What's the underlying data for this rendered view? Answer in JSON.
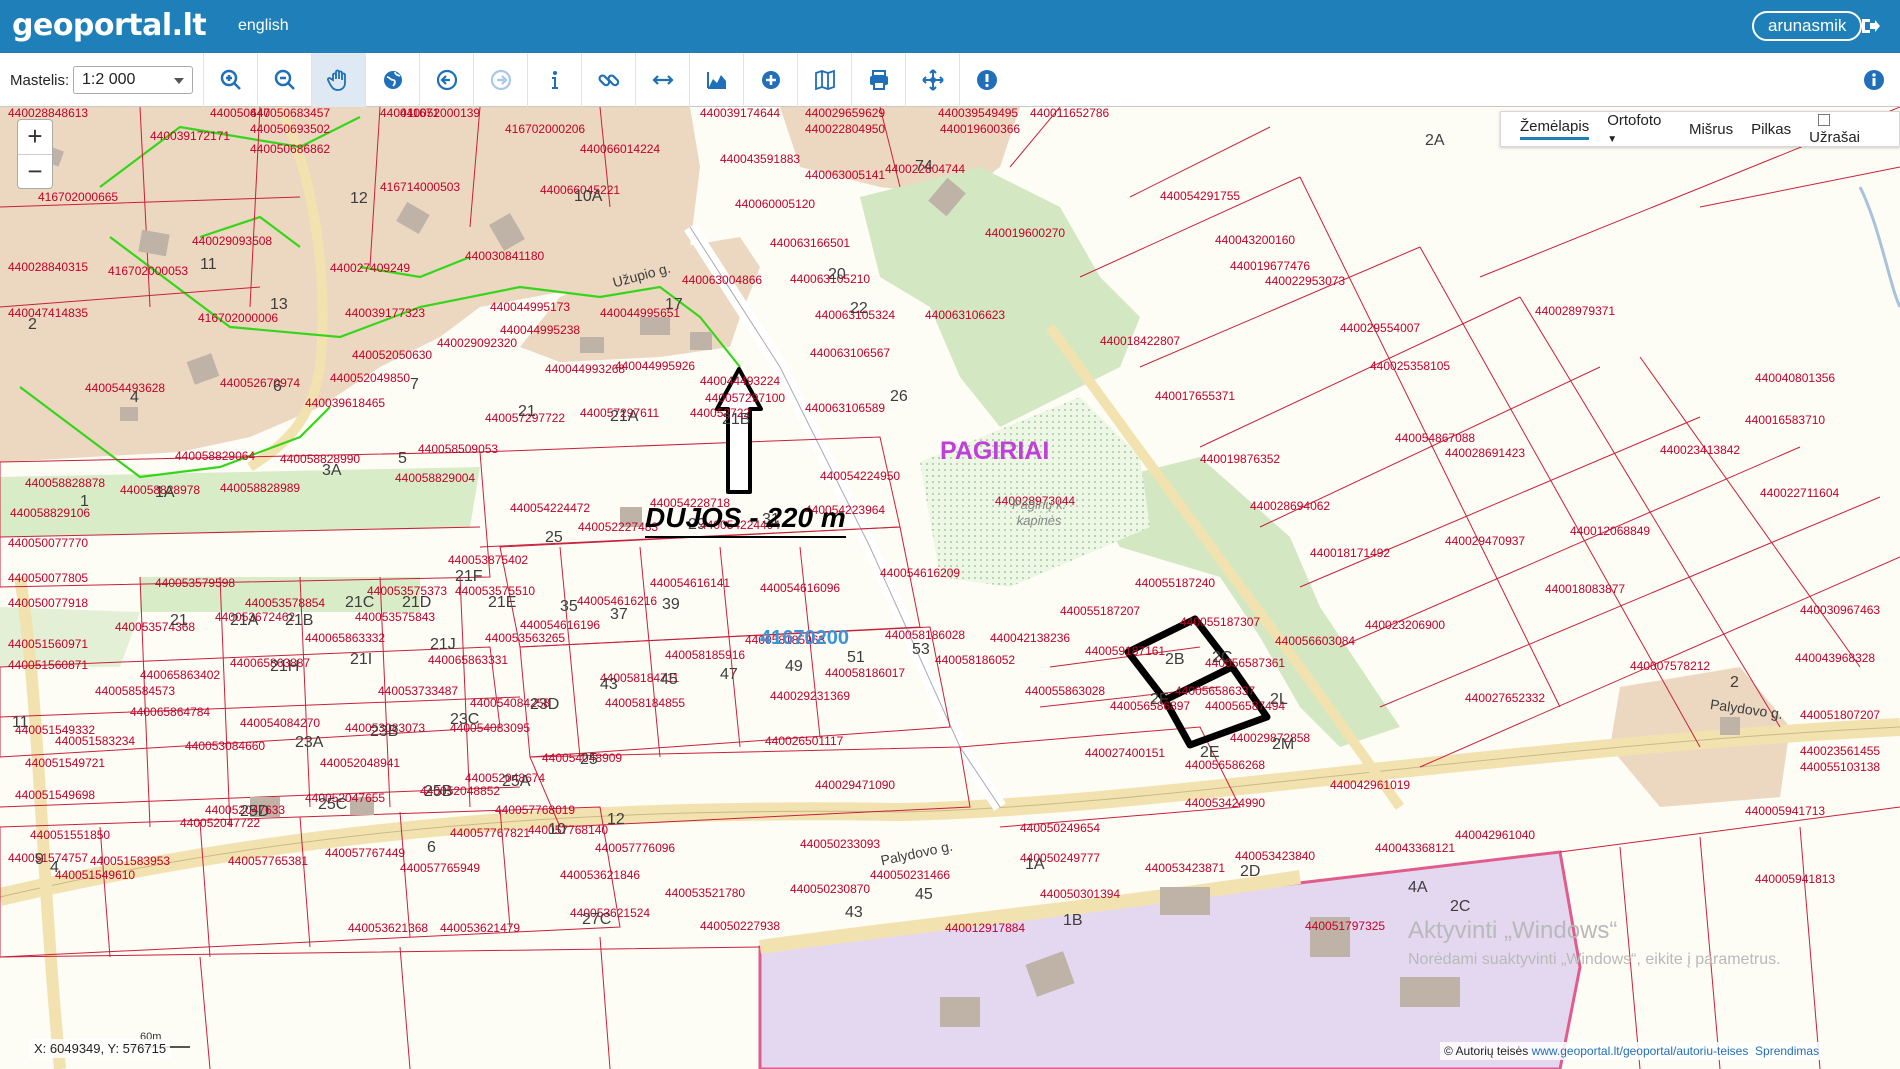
{
  "header": {
    "logo_text": "geoportal.lt",
    "language_link": "english",
    "user_button": "arunasmik"
  },
  "toolbar": {
    "scale_label": "Mastelis:",
    "scale_value": "1:2 000",
    "tools": [
      "zoom-in-tool",
      "zoom-out-tool",
      "pan-hand-tool",
      "globe-tool",
      "back-tool",
      "forward-tool",
      "identify-info-tool",
      "link-tool",
      "measure-distance-tool",
      "profile-tool",
      "add-point-tool",
      "map-tool",
      "print-tool",
      "center-tool",
      "alert-tool"
    ]
  },
  "map": {
    "zoom_in": "+",
    "zoom_out": "−",
    "layers": {
      "zemelapis": "Žemėlapis",
      "ortofoto": "Ortofoto",
      "misrus": "Mišrus",
      "pilkas": "Pilkas",
      "uzrasai": "Užrašai"
    },
    "place_name": "PAGIRIAI",
    "cemetery_line1": "Pagirių k.",
    "cemetery_line2": "kapinės",
    "parcel_block": "41670200",
    "annotation": "DUJOS - 220 m",
    "street_uzupio": "Užupio g.",
    "street_palydovo_1": "Palydovo g.",
    "street_palydovo_2": "Palydovo g.",
    "watermark_line1": "Aktyvinti „Windows“",
    "watermark_line2": "Norėdami suaktyvinti „Windows“, eikite į parametrus.",
    "coordinates": "X: 6049349, Y: 576715",
    "copyright_text": "© Autorių teisės",
    "copyright_link": "www.geoportal.lt/geoportal/autoriu-teises",
    "solutions_link": "Sprendimas",
    "scalebar": "60m"
  },
  "parcel_labels": [
    [
      "440028848613",
      8,
      0
    ],
    [
      "440050647",
      210,
      0
    ],
    [
      "440050683457",
      250,
      0
    ],
    [
      "440011671",
      380,
      0
    ],
    [
      "440052000139",
      400,
      0
    ],
    [
      "440039174644",
      700,
      0
    ],
    [
      "440029659629",
      805,
      0
    ],
    [
      "440039549495",
      938,
      0
    ],
    [
      "440011652786",
      1030,
      0
    ],
    [
      "440039172171",
      150,
      23
    ],
    [
      "440050693502",
      250,
      16
    ],
    [
      "416702000206",
      505,
      16
    ],
    [
      "440019600366",
      940,
      16
    ],
    [
      "440050686862",
      250,
      36
    ],
    [
      "440066014224",
      580,
      36
    ],
    [
      "440043591883",
      720,
      46
    ],
    [
      "440022804950",
      805,
      16
    ],
    [
      "440063005141",
      805,
      62
    ],
    [
      "440022804744",
      885,
      56
    ],
    [
      "416702000665",
      38,
      84
    ],
    [
      "416714000503",
      380,
      74
    ],
    [
      "440066045221",
      540,
      77
    ],
    [
      "440060005120",
      735,
      91
    ],
    [
      "440029093508",
      192,
      128
    ],
    [
      "440030841180",
      465,
      143
    ],
    [
      "440063166501",
      770,
      130
    ],
    [
      "440019600270",
      985,
      120
    ],
    [
      "440054291755",
      1160,
      83
    ],
    [
      "440043200160",
      1215,
      127
    ],
    [
      "440028840315",
      8,
      154
    ],
    [
      "416702000053",
      108,
      158
    ],
    [
      "440027409249",
      330,
      155
    ],
    [
      "440063004866",
      682,
      167
    ],
    [
      "440063105210",
      790,
      166
    ],
    [
      "440019677476",
      1230,
      153
    ],
    [
      "440022953073",
      1265,
      168
    ],
    [
      "440044995651",
      600,
      200
    ],
    [
      "440044995173",
      490,
      194
    ],
    [
      "440039177323",
      345,
      200
    ],
    [
      "440063105324",
      815,
      202
    ],
    [
      "440063106623",
      925,
      202
    ],
    [
      "440047414835",
      8,
      200
    ],
    [
      "416702000006",
      198,
      205
    ],
    [
      "440044995238",
      500,
      217
    ],
    [
      "440052050630",
      352,
      242
    ],
    [
      "440029092320",
      437,
      230
    ],
    [
      "440018422807",
      1100,
      228
    ],
    [
      "440029554007",
      1340,
      215
    ],
    [
      "440028979371",
      1535,
      198
    ],
    [
      "440052049850",
      330,
      265
    ],
    [
      "440044993268",
      545,
      256
    ],
    [
      "440044995926",
      615,
      253
    ],
    [
      "440063106567",
      810,
      240
    ],
    [
      "440025358105",
      1370,
      253
    ],
    [
      "440040801356",
      1755,
      265
    ],
    [
      "440054493628",
      85,
      275
    ],
    [
      "440052670974",
      220,
      270
    ],
    [
      "440039618465",
      305,
      290
    ],
    [
      "440044493224",
      700,
      268
    ],
    [
      "440057297100",
      705,
      285
    ],
    [
      "440063106589",
      805,
      295
    ],
    [
      "440017655371",
      1155,
      283
    ],
    [
      "440016583710",
      1745,
      307
    ],
    [
      "440057297722",
      485,
      305
    ],
    [
      "440057297611",
      580,
      300
    ],
    [
      "440052722",
      690,
      300
    ],
    [
      "440054867088",
      1395,
      325
    ],
    [
      "440028691423",
      1445,
      340
    ],
    [
      "440023413842",
      1660,
      337
    ],
    [
      "440058829064",
      175,
      343
    ],
    [
      "440058828990",
      280,
      346
    ],
    [
      "440058829004",
      395,
      365
    ],
    [
      "440058509053",
      418,
      336
    ],
    [
      "440019876352",
      1200,
      346
    ],
    [
      "440058828878",
      25,
      370
    ],
    [
      "440058828978",
      120,
      377
    ],
    [
      "440058828989",
      220,
      375
    ],
    [
      "440054224950",
      820,
      363
    ],
    [
      "440028973044",
      995,
      388
    ],
    [
      "440028694062",
      1250,
      393
    ],
    [
      "440022711604",
      1760,
      380
    ],
    [
      "440054224472",
      510,
      395
    ],
    [
      "440054228718",
      650,
      390
    ],
    [
      "440054223964",
      805,
      397
    ],
    [
      "440058829106",
      10,
      400
    ],
    [
      "440052227483",
      578,
      414
    ],
    [
      "440054224494",
      700,
      412
    ],
    [
      "440012068849",
      1570,
      418
    ],
    [
      "440029470937",
      1445,
      428
    ],
    [
      "440050077770",
      8,
      430
    ],
    [
      "440018171492",
      1310,
      440
    ],
    [
      "440053875402",
      448,
      447
    ],
    [
      "440054616209",
      880,
      460
    ],
    [
      "440050077805",
      8,
      465
    ],
    [
      "440053579598",
      155,
      470
    ],
    [
      "440054616141",
      650,
      470
    ],
    [
      "440054616096",
      760,
      475
    ],
    [
      "440055187240",
      1135,
      470
    ],
    [
      "440018083877",
      1545,
      476
    ],
    [
      "440050077918",
      8,
      490
    ],
    [
      "440053575373",
      367,
      478
    ],
    [
      "440053575510",
      455,
      478
    ],
    [
      "440054616216",
      577,
      488
    ],
    [
      "440053578854",
      245,
      490
    ],
    [
      "440053672462",
      215,
      504
    ],
    [
      "440053575843",
      355,
      504
    ],
    [
      "440053574368",
      115,
      514
    ],
    [
      "440055187207",
      1060,
      498
    ],
    [
      "440055187307",
      1180,
      509
    ],
    [
      "440030967463",
      1800,
      497
    ],
    [
      "440054616196",
      520,
      512
    ],
    [
      "440058186028",
      885,
      522
    ],
    [
      "440042138236",
      990,
      525
    ],
    [
      "440065863332",
      305,
      525
    ],
    [
      "440053563265",
      485,
      525
    ],
    [
      "440058185963",
      745,
      527
    ],
    [
      "440056603084",
      1275,
      528
    ],
    [
      "440023206900",
      1365,
      512
    ],
    [
      "440051560971",
      8,
      531
    ],
    [
      "440058185916",
      665,
      542
    ],
    [
      "440059187161",
      1085,
      538
    ],
    [
      "440058186052",
      935,
      547
    ],
    [
      "440056587361",
      1205,
      550
    ],
    [
      "440007578212",
      1630,
      553
    ],
    [
      "440043968328",
      1795,
      545
    ],
    [
      "440065863887",
      230,
      550
    ],
    [
      "440065863331",
      428,
      547
    ],
    [
      "440051560871",
      8,
      552
    ],
    [
      "440065863402",
      140,
      562
    ],
    [
      "440058184711",
      600,
      565
    ],
    [
      "440058186017",
      825,
      560
    ],
    [
      "440055863028",
      1025,
      578
    ],
    [
      "440056586337",
      1175,
      578
    ],
    [
      "440058584573",
      95,
      578
    ],
    [
      "440053733487",
      378,
      578
    ],
    [
      "440054084258",
      470,
      590
    ],
    [
      "440058184855",
      605,
      590
    ],
    [
      "440029231369",
      770,
      583
    ],
    [
      "440056586897",
      1110,
      593
    ],
    [
      "440056587494",
      1205,
      593
    ],
    [
      "440027652332",
      1465,
      585
    ],
    [
      "440065864784",
      130,
      599
    ],
    [
      "440051807207",
      1808,
      602
    ],
    [
      "440054084270",
      240,
      610
    ],
    [
      "440053083073",
      345,
      615
    ],
    [
      "440054083095",
      450,
      615
    ],
    [
      "440051549332",
      15,
      617
    ],
    [
      "440051583234",
      55,
      628
    ],
    [
      "440053084660",
      185,
      633
    ],
    [
      "440026501117",
      765,
      628
    ],
    [
      "440029872858",
      1230,
      625
    ],
    [
      "440023561455",
      1800,
      638
    ],
    [
      "440051549721",
      25,
      650
    ],
    [
      "440052048941",
      320,
      650
    ],
    [
      "440054048909",
      542,
      645
    ],
    [
      "440027400151",
      1085,
      640
    ],
    [
      "440056586268",
      1185,
      652
    ],
    [
      "440055103138",
      1820,
      654
    ],
    [
      "440052048674",
      465,
      665
    ],
    [
      "440051549698",
      15,
      682
    ],
    [
      "440052047655",
      305,
      685
    ],
    [
      "440052048852",
      420,
      678
    ],
    [
      "440029471090",
      815,
      672
    ],
    [
      "440042961019",
      1330,
      672
    ],
    [
      "440053424990",
      1185,
      690
    ],
    [
      "440052047633",
      205,
      697
    ],
    [
      "440057768019",
      495,
      697
    ],
    [
      "440005941713",
      1745,
      698
    ],
    [
      "440052047722",
      180,
      710
    ],
    [
      "440057768140",
      528,
      717
    ],
    [
      "440042961040",
      1455,
      722
    ],
    [
      "440051551850",
      30,
      722
    ],
    [
      "440057767821",
      450,
      720
    ],
    [
      "440050233093",
      800,
      731
    ],
    [
      "440057767449",
      325,
      740
    ],
    [
      "440057776096",
      595,
      735
    ],
    [
      "440051574757",
      8,
      745
    ],
    [
      "440057765381",
      228,
      748
    ],
    [
      "440051583953",
      90,
      748
    ],
    [
      "440057765949",
      400,
      755
    ],
    [
      "440050249654",
      1020,
      715
    ],
    [
      "440050249777",
      1020,
      745
    ],
    [
      "440053423871",
      1145,
      755
    ],
    [
      "440053423840",
      1235,
      743
    ],
    [
      "440043368121",
      1375,
      735
    ],
    [
      "440051549610",
      55,
      762
    ],
    [
      "440050231466",
      870,
      762
    ],
    [
      "440053621846",
      560,
      762
    ],
    [
      "440005941813",
      1755,
      766
    ],
    [
      "440050230870",
      790,
      776
    ],
    [
      "440053521780",
      665,
      780
    ],
    [
      "440050301394",
      1040,
      781
    ],
    [
      "440053621524",
      570,
      800
    ],
    [
      "440053621368",
      348,
      815
    ],
    [
      "440053621479",
      440,
      815
    ],
    [
      "440050227938",
      700,
      813
    ],
    [
      "440012917884",
      945,
      815
    ],
    [
      "440051797325",
      1305,
      813
    ]
  ],
  "house_numbers": [
    [
      "12",
      350,
      84
    ],
    [
      "10A",
      574,
      82
    ],
    [
      "74",
      915,
      52
    ],
    [
      "2A",
      1425,
      26
    ],
    [
      "11",
      200,
      150
    ],
    [
      "13",
      270,
      190
    ],
    [
      "17",
      665,
      190
    ],
    [
      "2",
      28,
      210
    ],
    [
      "6",
      273,
      272
    ],
    [
      "7",
      410,
      270
    ],
    [
      "4",
      130,
      283
    ],
    [
      "20",
      828,
      160
    ],
    [
      "22",
      850,
      194
    ],
    [
      "26",
      890,
      282
    ],
    [
      "21",
      518,
      297
    ],
    [
      "21A",
      610,
      302
    ],
    [
      "21B",
      722,
      305
    ],
    [
      "5",
      398,
      344
    ],
    [
      "3A",
      322,
      356
    ],
    [
      "1A",
      155,
      378
    ],
    [
      "1",
      80,
      387
    ],
    [
      "31",
      762,
      405
    ],
    [
      "29",
      688,
      410
    ],
    [
      "25",
      545,
      423
    ],
    [
      "21C",
      345,
      488
    ],
    [
      "21F",
      455,
      462
    ],
    [
      "21D",
      402,
      488
    ],
    [
      "21E",
      488,
      488
    ],
    [
      "35",
      560,
      492
    ],
    [
      "37",
      610,
      500
    ],
    [
      "39",
      662,
      490
    ],
    [
      "21",
      170,
      506
    ],
    [
      "21A",
      230,
      506
    ],
    [
      "21B",
      285,
      506
    ],
    [
      "21J",
      430,
      530
    ],
    [
      "21I",
      350,
      545
    ],
    [
      "21H",
      270,
      552
    ],
    [
      "53",
      912,
      535
    ],
    [
      "51",
      847,
      543
    ],
    [
      "49",
      785,
      552
    ],
    [
      "47",
      720,
      560
    ],
    [
      "45",
      660,
      565
    ],
    [
      "43",
      600,
      570
    ],
    [
      "23D",
      530,
      590
    ],
    [
      "23C",
      450,
      605
    ],
    [
      "23B",
      370,
      617
    ],
    [
      "23A",
      295,
      628
    ],
    [
      "2",
      1730,
      568
    ],
    [
      "11",
      12,
      608
    ],
    [
      "2F",
      1150,
      585
    ],
    [
      "2E",
      1200,
      638
    ],
    [
      "2L",
      1270,
      585
    ],
    [
      "2M",
      1272,
      630
    ],
    [
      "25",
      580,
      645
    ],
    [
      "25A",
      502,
      667
    ],
    [
      "25B",
      424,
      677
    ],
    [
      "25C",
      318,
      690
    ],
    [
      "25D",
      240,
      697
    ],
    [
      "12",
      607,
      705
    ],
    [
      "10",
      548,
      715
    ],
    [
      "6",
      427,
      733
    ],
    [
      "4",
      50,
      753
    ],
    [
      "9",
      35,
      745
    ],
    [
      "1A",
      1025,
      750
    ],
    [
      "2D",
      1240,
      757
    ],
    [
      "4A",
      1408,
      773
    ],
    [
      "45",
      915,
      780
    ],
    [
      "43",
      845,
      798
    ],
    [
      "27C",
      582,
      805
    ],
    [
      "1B",
      1063,
      806
    ],
    [
      "2C",
      1450,
      792
    ],
    [
      "2B",
      1165,
      545
    ],
    [
      "2C",
      1212,
      543
    ]
  ]
}
